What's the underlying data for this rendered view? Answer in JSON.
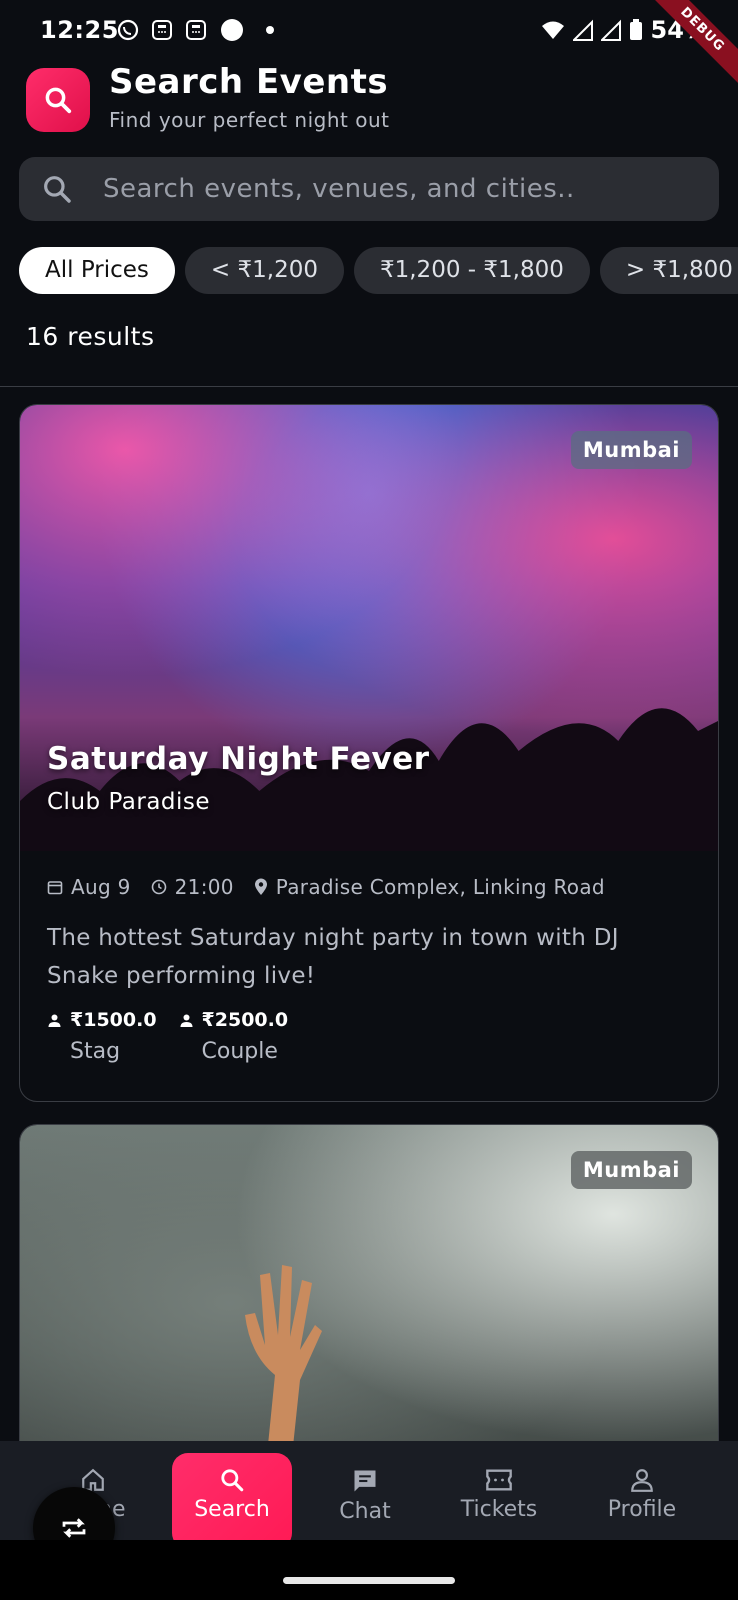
{
  "status_bar": {
    "time": "12:25",
    "battery": "54%",
    "debug": "DEBUG"
  },
  "header": {
    "title": "Search Events",
    "subtitle": "Find your perfect night out"
  },
  "search": {
    "placeholder": "Search events, venues, and cities.."
  },
  "filters": {
    "chips": [
      "All Prices",
      "< ₹1,200",
      "₹1,200 - ₹1,800",
      "> ₹1,800"
    ],
    "active_index": 0
  },
  "results": {
    "count_text": "16 results"
  },
  "events": [
    {
      "city": "Mumbai",
      "title": "Saturday Night Fever",
      "venue": "Club Paradise",
      "date": "Aug 9",
      "time": "21:00",
      "location": "Paradise Complex, Linking Road",
      "description": "The hottest Saturday night party in town with DJ Snake performing live!",
      "prices": [
        {
          "amount": "₹1500.0",
          "label": "Stag"
        },
        {
          "amount": "₹2500.0",
          "label": "Couple"
        }
      ]
    },
    {
      "city": "Mumbai"
    }
  ],
  "nav": {
    "items": [
      {
        "label": "Home",
        "icon": "home-icon"
      },
      {
        "label": "Search",
        "icon": "search-icon"
      },
      {
        "label": "Chat",
        "icon": "chat-icon"
      },
      {
        "label": "Tickets",
        "icon": "ticket-icon"
      },
      {
        "label": "Profile",
        "icon": "profile-icon"
      }
    ],
    "active": "Search"
  },
  "colors": {
    "accent": "#ff2d6a",
    "background": "#0b0d12",
    "surface": "#2b2d33",
    "nav": "#1a1d24"
  }
}
